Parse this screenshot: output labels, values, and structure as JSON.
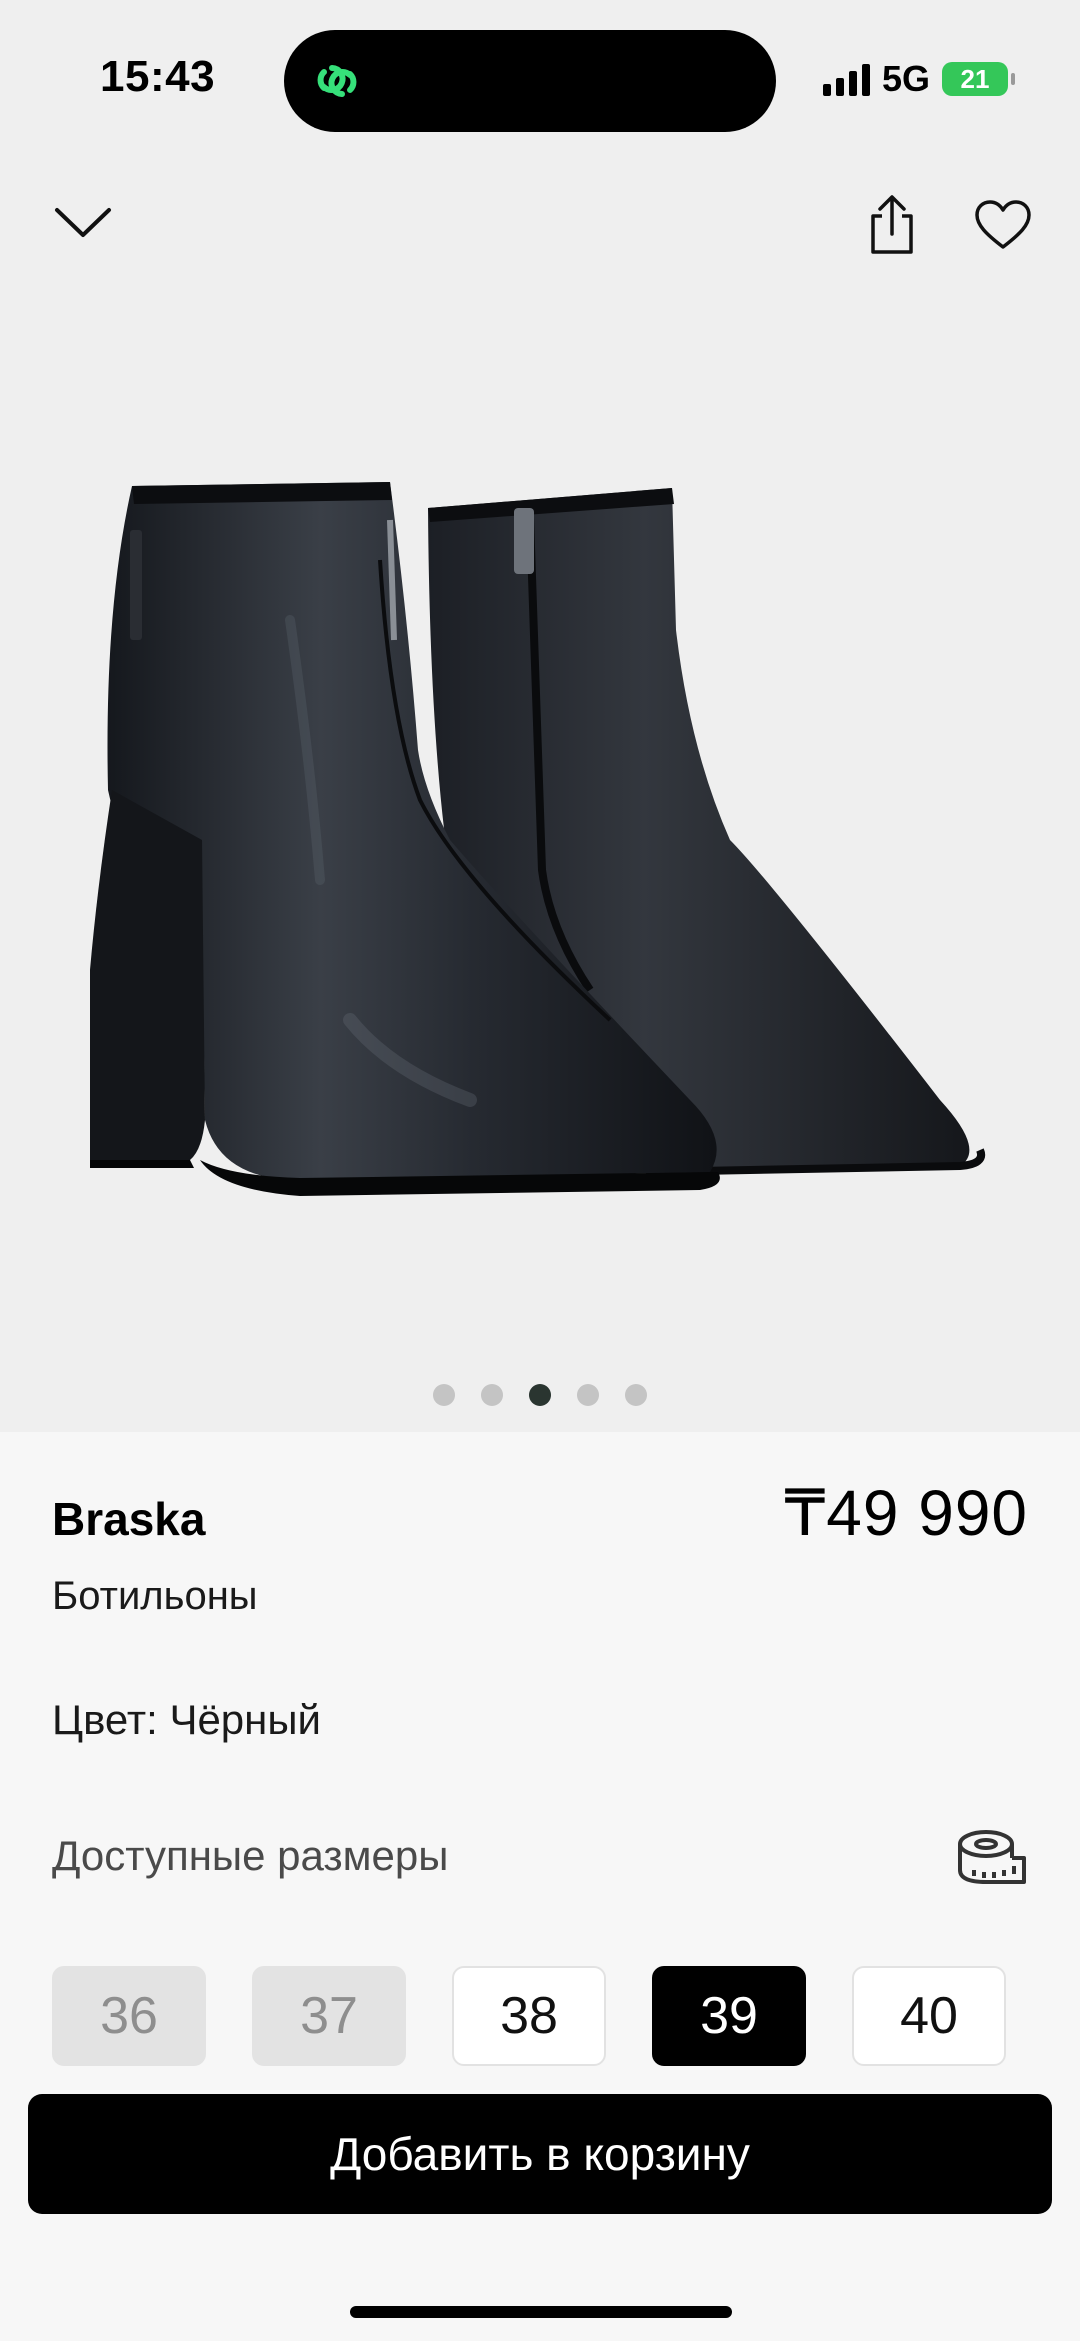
{
  "status_bar": {
    "time": "15:43",
    "network": "5G",
    "battery": "21",
    "icons": [
      "app-link-icon",
      "signal-icon",
      "battery-charging-icon"
    ]
  },
  "colors": {
    "accent_green": "#34c759",
    "selected_size": "#000000",
    "disabled_size": "#e3e3e3"
  },
  "top_bar": {
    "icons": [
      "chevron-down-icon",
      "share-icon",
      "heart-icon"
    ]
  },
  "gallery": {
    "image": "black-ankle-boots",
    "dots_total": 5,
    "active_index": 3
  },
  "product": {
    "brand": "Braska",
    "price": "₸49 990",
    "category": "Ботильоны",
    "color_label": "Цвет: Чёрный",
    "sizes_title": "Доступные размеры"
  },
  "sizes": [
    {
      "label": "36",
      "state": "unavailable"
    },
    {
      "label": "37",
      "state": "unavailable"
    },
    {
      "label": "38",
      "state": "available"
    },
    {
      "label": "39",
      "state": "selected"
    },
    {
      "label": "40",
      "state": "available"
    }
  ],
  "cart": {
    "button_label": "Добавить в корзину"
  }
}
